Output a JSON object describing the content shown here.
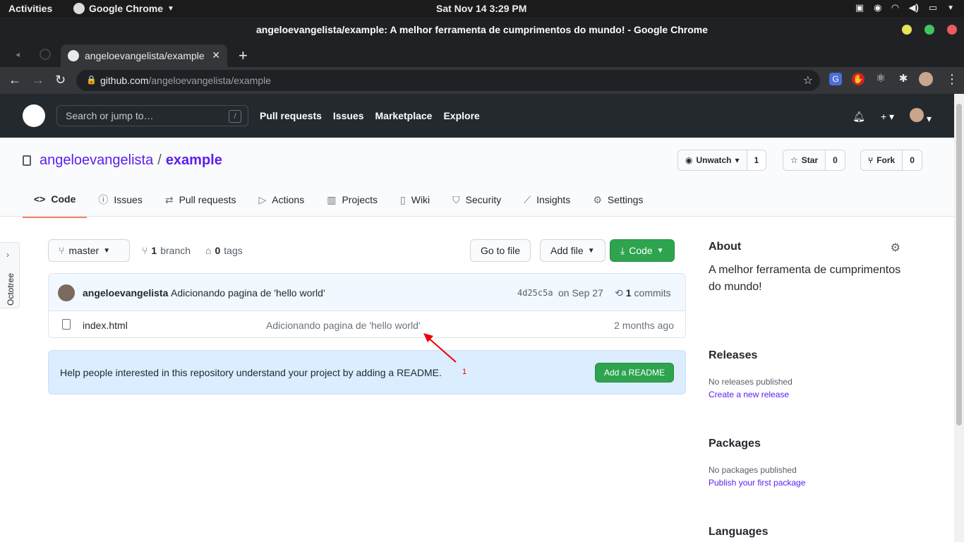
{
  "os": {
    "activities": "Activities",
    "app_name": "Google Chrome",
    "clock": "Sat Nov 14   3:29 PM"
  },
  "browser": {
    "window_title": "angeloevangelista/example: A melhor ferramenta de cumprimentos do mundo! - Google Chrome",
    "tab_title": "angeloevangelista/example: A",
    "url_host": "github.com",
    "url_path": "/angeloevangelista/example"
  },
  "github": {
    "search_placeholder": "Search or jump to…",
    "search_shortcut": "/",
    "nav": [
      "Pull requests",
      "Issues",
      "Marketplace",
      "Explore"
    ],
    "repo": {
      "owner": "angeloevangelista",
      "separator": "/",
      "name": "example",
      "unwatch_label": "Unwatch",
      "unwatch_count": "1",
      "star_label": "Star",
      "star_count": "0",
      "fork_label": "Fork",
      "fork_count": "0"
    },
    "tabs": [
      {
        "label": "Code",
        "icon": "code-icon"
      },
      {
        "label": "Issues",
        "icon": "issue-icon"
      },
      {
        "label": "Pull requests",
        "icon": "pull-request-icon"
      },
      {
        "label": "Actions",
        "icon": "play-icon"
      },
      {
        "label": "Projects",
        "icon": "project-icon"
      },
      {
        "label": "Wiki",
        "icon": "book-icon"
      },
      {
        "label": "Security",
        "icon": "shield-icon"
      },
      {
        "label": "Insights",
        "icon": "graph-icon"
      },
      {
        "label": "Settings",
        "icon": "gear-icon"
      }
    ],
    "octotree_label": "Octotree",
    "branch": "master",
    "branch_count": "1",
    "branch_label": "branch",
    "tag_count": "0",
    "tag_label": "tags",
    "goto_file": "Go to file",
    "add_file": "Add file",
    "code_button": "Code",
    "commit": {
      "author": "angeloevangelista",
      "message": "Adicionando pagina de 'hello world'",
      "sha": "4d25c5a",
      "date": "on Sep 27",
      "commit_count": "1",
      "commit_label": "commits"
    },
    "files": [
      {
        "name": "index.html",
        "message": "Adicionando pagina de 'hello world'",
        "age": "2 months ago"
      }
    ],
    "readme_prompt": "Help people interested in this repository understand your project by adding a README.",
    "readme_button": "Add a README",
    "annotation_number": "1",
    "about": {
      "title": "About",
      "description": "A melhor ferramenta de cumprimentos do mundo!"
    },
    "releases": {
      "title": "Releases",
      "empty": "No releases published",
      "link": "Create a new release"
    },
    "packages": {
      "title": "Packages",
      "empty": "No packages published",
      "link": "Publish your first package"
    },
    "languages": {
      "title": "Languages"
    }
  }
}
